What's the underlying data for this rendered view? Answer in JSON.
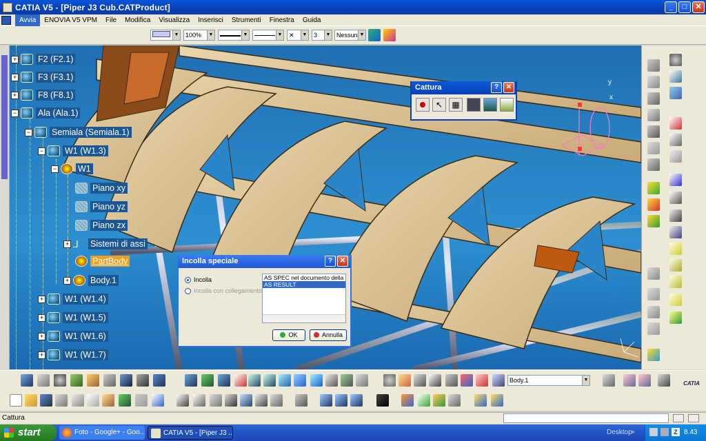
{
  "window": {
    "title": "CATIA V5 - [Piper J3 Cub.CATProduct]",
    "min": "_",
    "max": "□",
    "close": "✕"
  },
  "menubar": [
    "Avvia",
    "ENOVIA V5 VPM",
    "File",
    "Modifica",
    "Visualizza",
    "Inserisci",
    "Strumenti",
    "Finestra",
    "Guida"
  ],
  "toolbar_top": {
    "zoom": "100%",
    "layer": "Nessuno",
    "x_combo": "✕",
    "ptype": "3"
  },
  "tree": [
    {
      "label": "F2 (F2.1)",
      "icon": "product-icon"
    },
    {
      "label": "F3 (F3.1)",
      "icon": "product-icon"
    },
    {
      "label": "F8 (F8.1)",
      "icon": "product-icon"
    },
    {
      "label": "Ala (Ala.1)",
      "icon": "product-icon"
    },
    {
      "label": "Semiala (Semiala.1)",
      "icon": "product-icon"
    },
    {
      "label": "W1 (W1.3)",
      "icon": "part-icon"
    },
    {
      "label": "W1",
      "icon": "gear-icon"
    },
    {
      "label": "Piano xy",
      "icon": "plane-icon"
    },
    {
      "label": "Piano yz",
      "icon": "plane-icon"
    },
    {
      "label": "Piano zx",
      "icon": "plane-icon"
    },
    {
      "label": "Sistemi di assi",
      "icon": "axis-icon"
    },
    {
      "label": "PartBody",
      "icon": "gear-icon"
    },
    {
      "label": "Body.1",
      "icon": "gear-icon"
    },
    {
      "label": "W1 (W1.4)",
      "icon": "part-icon"
    },
    {
      "label": "W1 (W1.5)",
      "icon": "part-icon"
    },
    {
      "label": "W1 (W1.6)",
      "icon": "part-icon"
    },
    {
      "label": "W1 (W1.7)",
      "icon": "part-icon"
    }
  ],
  "cattura": {
    "title": "Cattura",
    "help": "?",
    "close": "✕"
  },
  "incolla": {
    "title": "Incolla speciale",
    "help": "?",
    "close": "✕",
    "opt1": "Incolla",
    "opt2": "Incolla con collegamento",
    "list": [
      "AS SPEC nel documento della p",
      "AS RESULT"
    ],
    "ok": "OK",
    "annulla": "Annulla"
  },
  "axis_labels": {
    "x": "x",
    "y": "y"
  },
  "bottom_toolbar": {
    "body_combo": "Body.1",
    "catia_logo": "CATIA"
  },
  "status": {
    "text": "Cattura"
  },
  "taskbar": {
    "start": "start",
    "tasks": [
      "Foto - Google+ - Goo...",
      "CATIA V5 - [Piper J3 ..."
    ],
    "desktop": "Desktop",
    "time": "8.43"
  }
}
